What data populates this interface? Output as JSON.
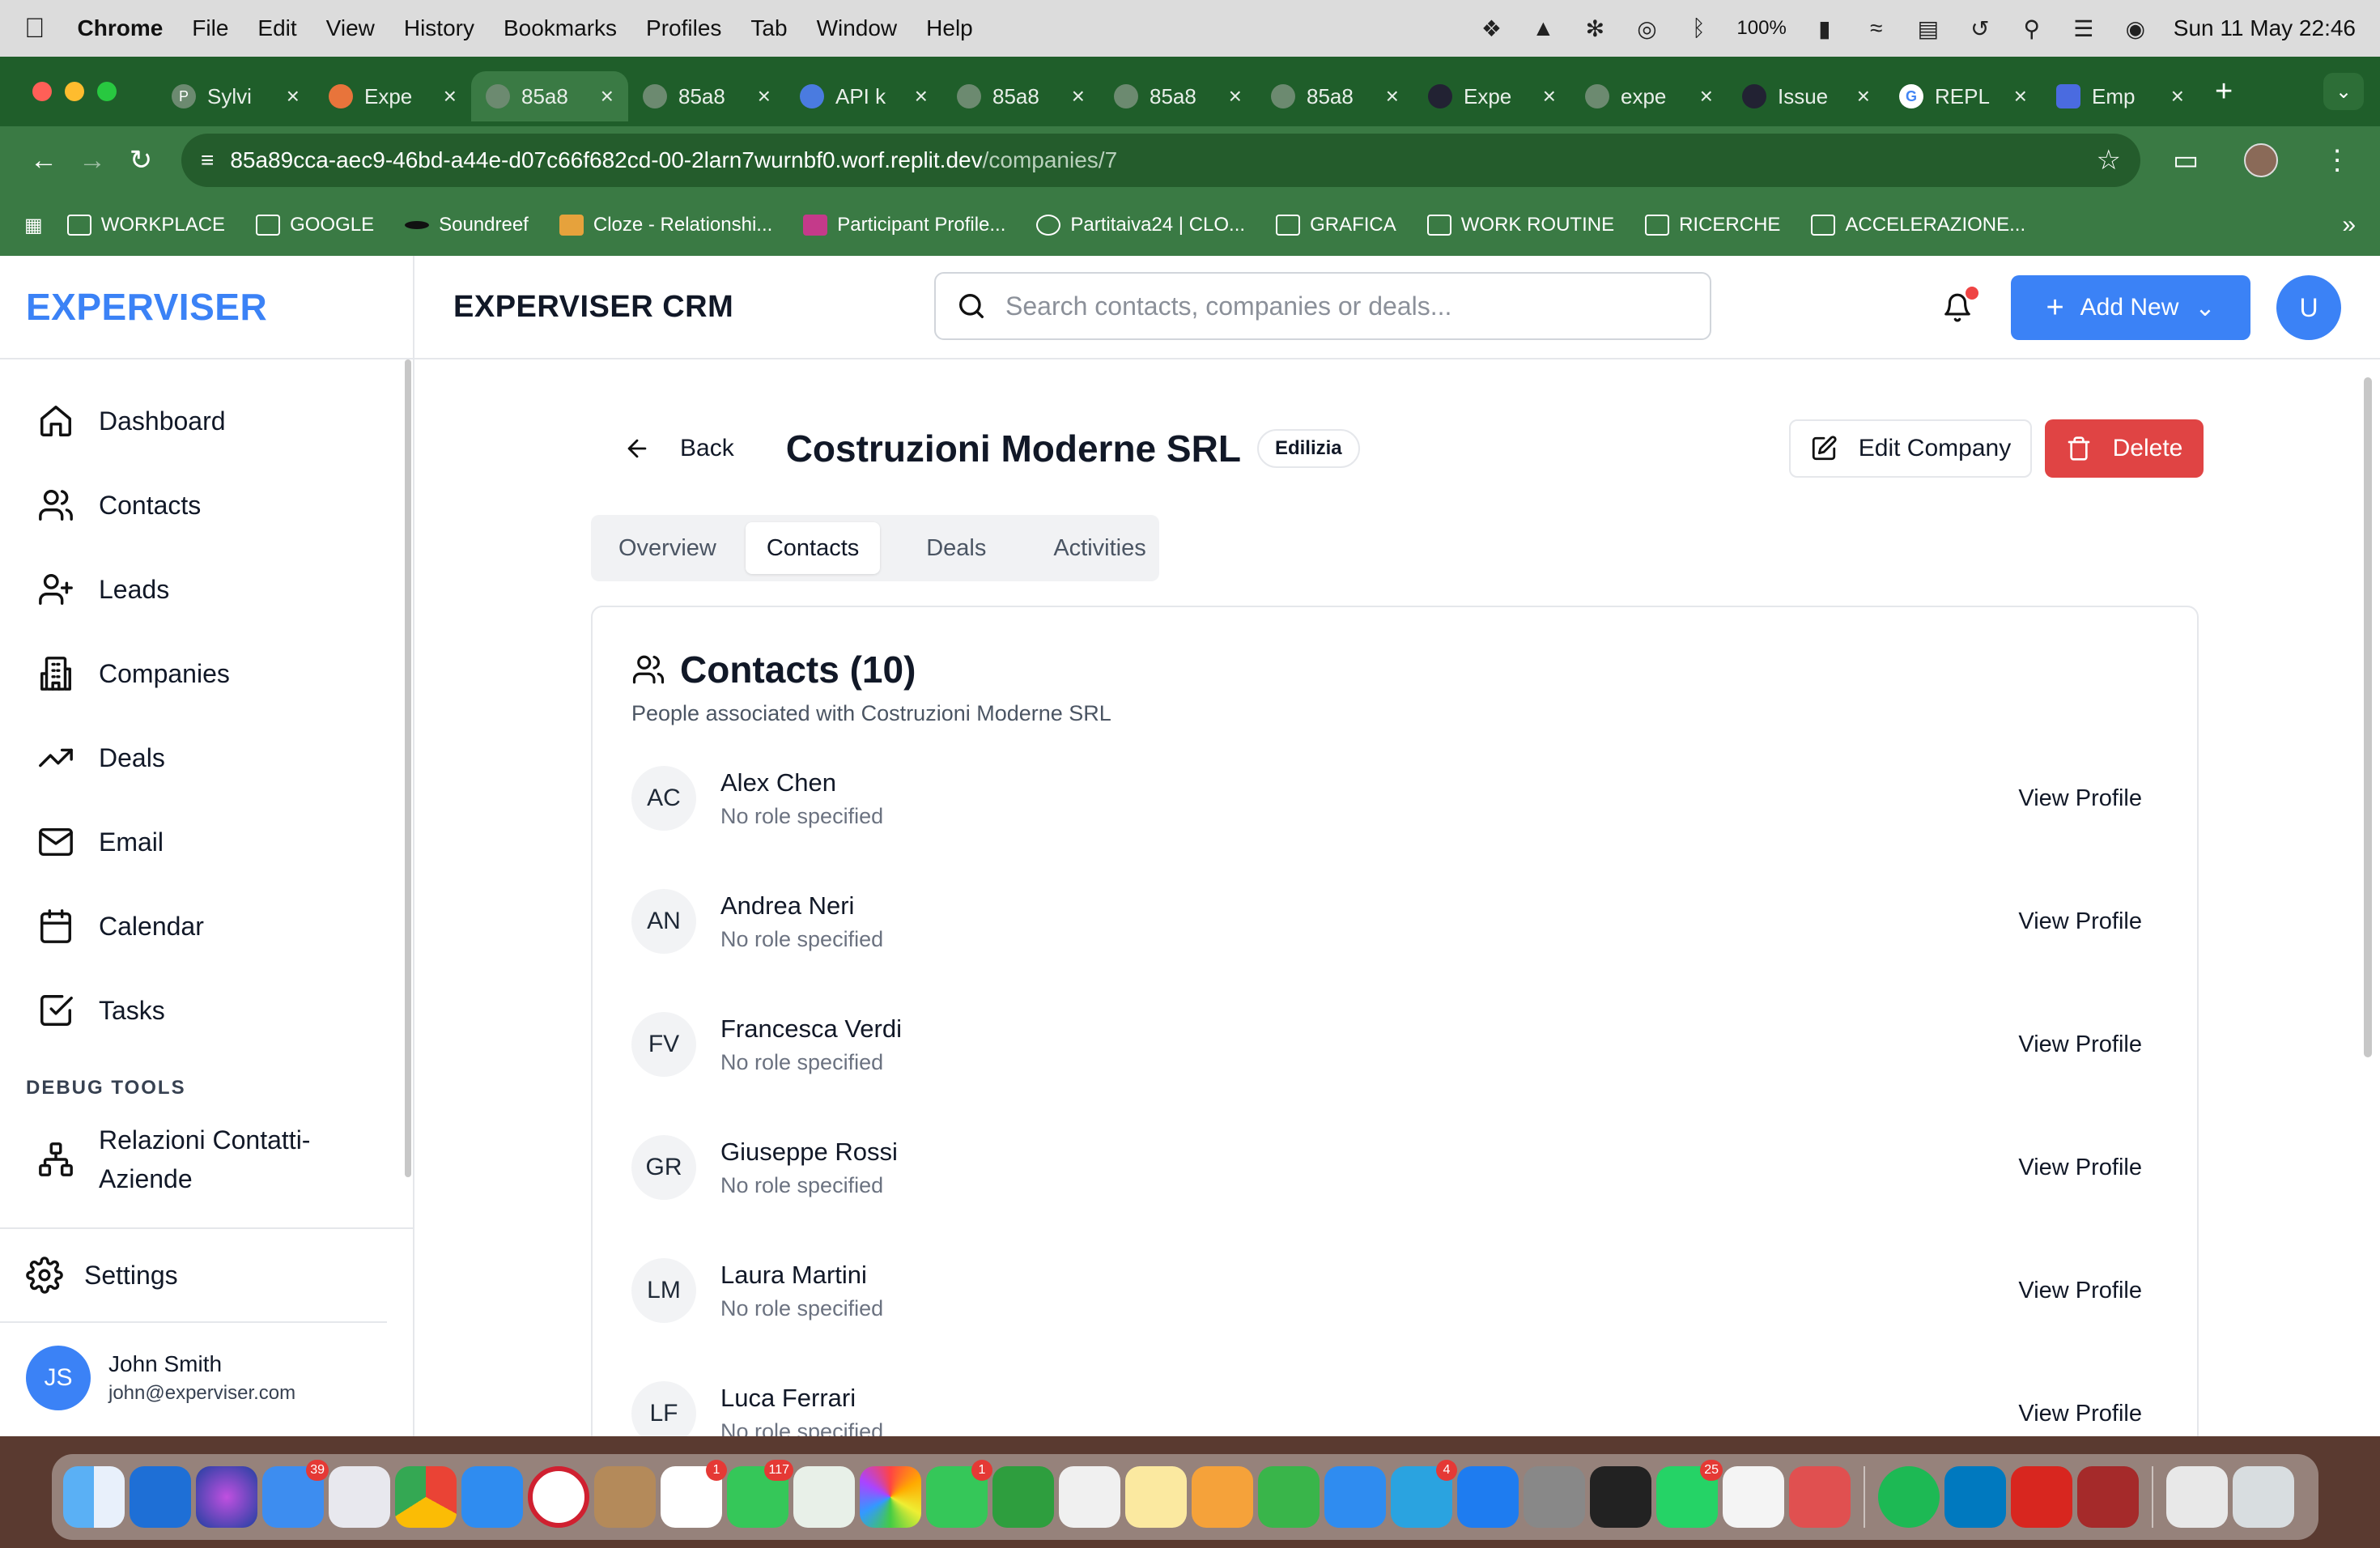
{
  "menubar": {
    "app": "Chrome",
    "items": [
      "File",
      "Edit",
      "View",
      "History",
      "Bookmarks",
      "Profiles",
      "Tab",
      "Window",
      "Help"
    ],
    "battery": "100%",
    "datetime": "Sun 11 May  22:46"
  },
  "browser": {
    "tabs": [
      {
        "label": "Sylvi",
        "active": false
      },
      {
        "label": "Expe",
        "active": false
      },
      {
        "label": "85a8",
        "active": true
      },
      {
        "label": "85a8",
        "active": false
      },
      {
        "label": "API k",
        "active": false
      },
      {
        "label": "85a8",
        "active": false
      },
      {
        "label": "85a8",
        "active": false
      },
      {
        "label": "85a8",
        "active": false
      },
      {
        "label": "Expe",
        "active": false
      },
      {
        "label": "expe",
        "active": false
      },
      {
        "label": "Issue",
        "active": false
      },
      {
        "label": "REPL",
        "active": false
      },
      {
        "label": "Emp",
        "active": false
      }
    ],
    "url_main": "85a89cca-aec9-46bd-a44e-d07c66f682cd-00-2larn7wurnbf0.worf.replit.dev",
    "url_path": "/companies/7",
    "bookmarks": [
      "WORKPLACE",
      "GOOGLE",
      "Soundreef",
      "Cloze - Relationshi...",
      "Participant Profile...",
      "Partitaiva24 | CLO...",
      "GRAFICA",
      "WORK ROUTINE",
      "RICERCHE",
      "ACCELERAZIONE..."
    ]
  },
  "sidebar": {
    "brand": "EXPERVISER",
    "items": [
      {
        "label": "Dashboard",
        "icon": "home-icon"
      },
      {
        "label": "Contacts",
        "icon": "users-icon"
      },
      {
        "label": "Leads",
        "icon": "user-plus-icon"
      },
      {
        "label": "Companies",
        "icon": "building-icon"
      },
      {
        "label": "Deals",
        "icon": "trending-up-icon"
      },
      {
        "label": "Email",
        "icon": "mail-icon"
      },
      {
        "label": "Calendar",
        "icon": "calendar-icon"
      },
      {
        "label": "Tasks",
        "icon": "check-square-icon"
      }
    ],
    "debug_title": "DEBUG TOOLS",
    "debug_item_line1": "Relazioni Contatti-",
    "debug_item_line2": "Aziende",
    "settings": "Settings",
    "user": {
      "initials": "JS",
      "name": "John Smith",
      "email": "john@experviser.com"
    }
  },
  "topbar": {
    "title": "EXPERVISER CRM",
    "search_placeholder": "Search contacts, companies or deals...",
    "add_new": "Add New",
    "avatar": "U"
  },
  "company": {
    "back": "Back",
    "name": "Costruzioni Moderne SRL",
    "sector": "Edilizia",
    "edit": "Edit Company",
    "delete": "Delete",
    "tabs": [
      "Overview",
      "Contacts",
      "Deals",
      "Activities"
    ],
    "active_tab": "Contacts"
  },
  "contacts_card": {
    "title": "Contacts (10)",
    "subtitle": "People associated with Costruzioni Moderne SRL",
    "view_label": "View Profile",
    "items": [
      {
        "initials": "AC",
        "name": "Alex Chen",
        "role": "No role specified"
      },
      {
        "initials": "AN",
        "name": "Andrea Neri",
        "role": "No role specified"
      },
      {
        "initials": "FV",
        "name": "Francesca Verdi",
        "role": "No role specified"
      },
      {
        "initials": "GR",
        "name": "Giuseppe Rossi",
        "role": "No role specified"
      },
      {
        "initials": "LM",
        "name": "Laura Martini",
        "role": "No role specified"
      },
      {
        "initials": "LF",
        "name": "Luca Ferrari",
        "role": "No role specified"
      }
    ]
  },
  "dock": {
    "badges": {
      "mail": "39",
      "calendar": "1",
      "messages": "117",
      "facetime": "1",
      "telegram": "4",
      "whatsapp": "25"
    }
  }
}
